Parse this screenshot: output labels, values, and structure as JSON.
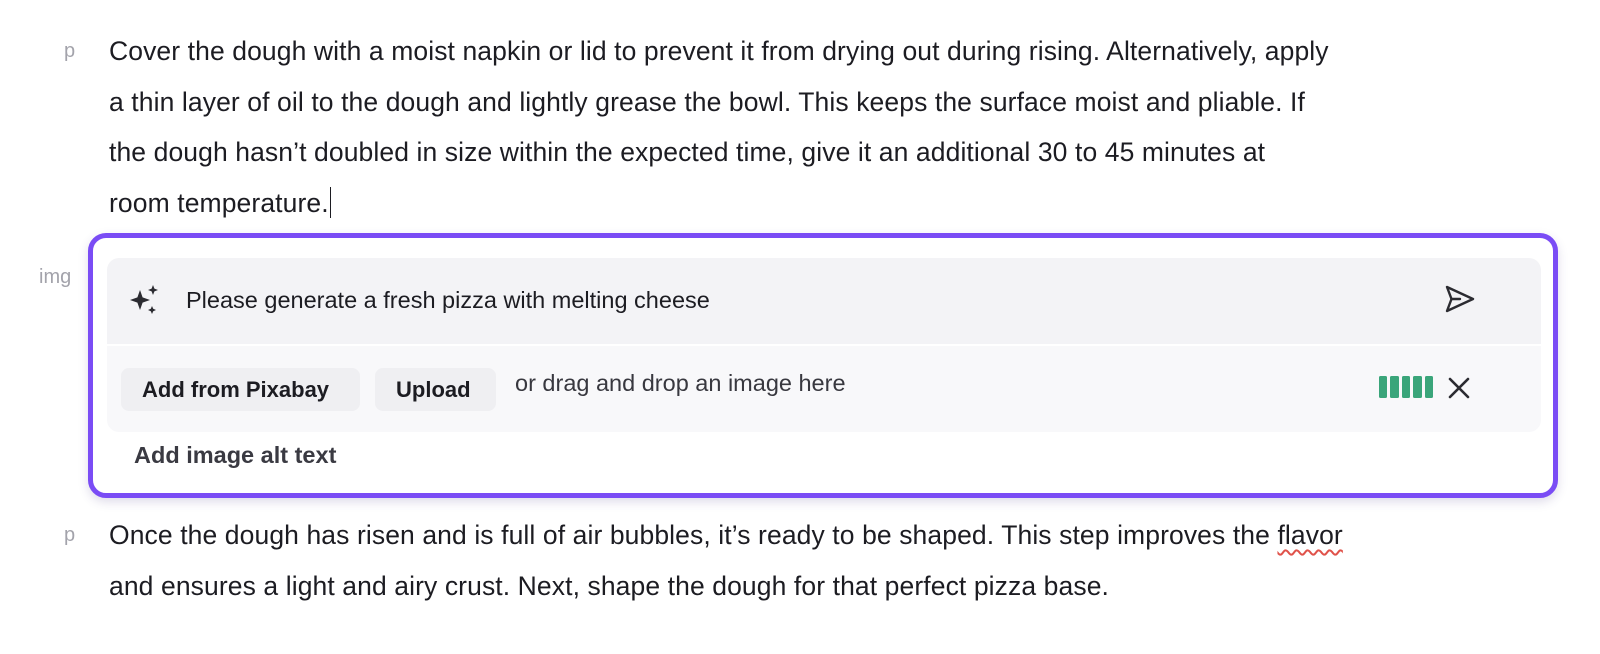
{
  "block_tags": {
    "p_top": "p",
    "img": "img",
    "p_bottom": "p"
  },
  "paragraph_top": {
    "lines": [
      "Cover the dough with a moist napkin or lid to prevent it from drying out during rising. Alternatively, apply",
      "a thin layer of oil to the dough and lightly grease the bowl. This keeps the surface moist and pliable. If",
      "the dough hasn’t doubled in size within the expected time, give it an additional 30 to 45 minutes at",
      "room temperature."
    ]
  },
  "image_block": {
    "prompt_value": "Please generate a fresh pizza with melting cheese",
    "sparkle_icon": "sparkles-icon",
    "send_icon": "send-icon",
    "add_from_pixabay_label": "Add from Pixabay",
    "upload_label": "Upload",
    "drop_hint": "or drag and drop an image here",
    "progress_icon": "progress-bars-icon",
    "progress": 1.0,
    "close_icon": "close-icon",
    "alt_text_label": "Add image alt text"
  },
  "paragraph_bottom": {
    "line1_before": "Once the dough has risen and is full of air bubbles, it’s ready to be shaped. This step improves the ",
    "line1_misspelled": "flavor",
    "line2": "and ensures a light and airy crust. Next, shape the dough for that perfect pizza base."
  },
  "colors": {
    "accent_border": "#7a4cf5",
    "progress_green": "#3aa57a",
    "spellcheck_red": "#e0524a"
  }
}
